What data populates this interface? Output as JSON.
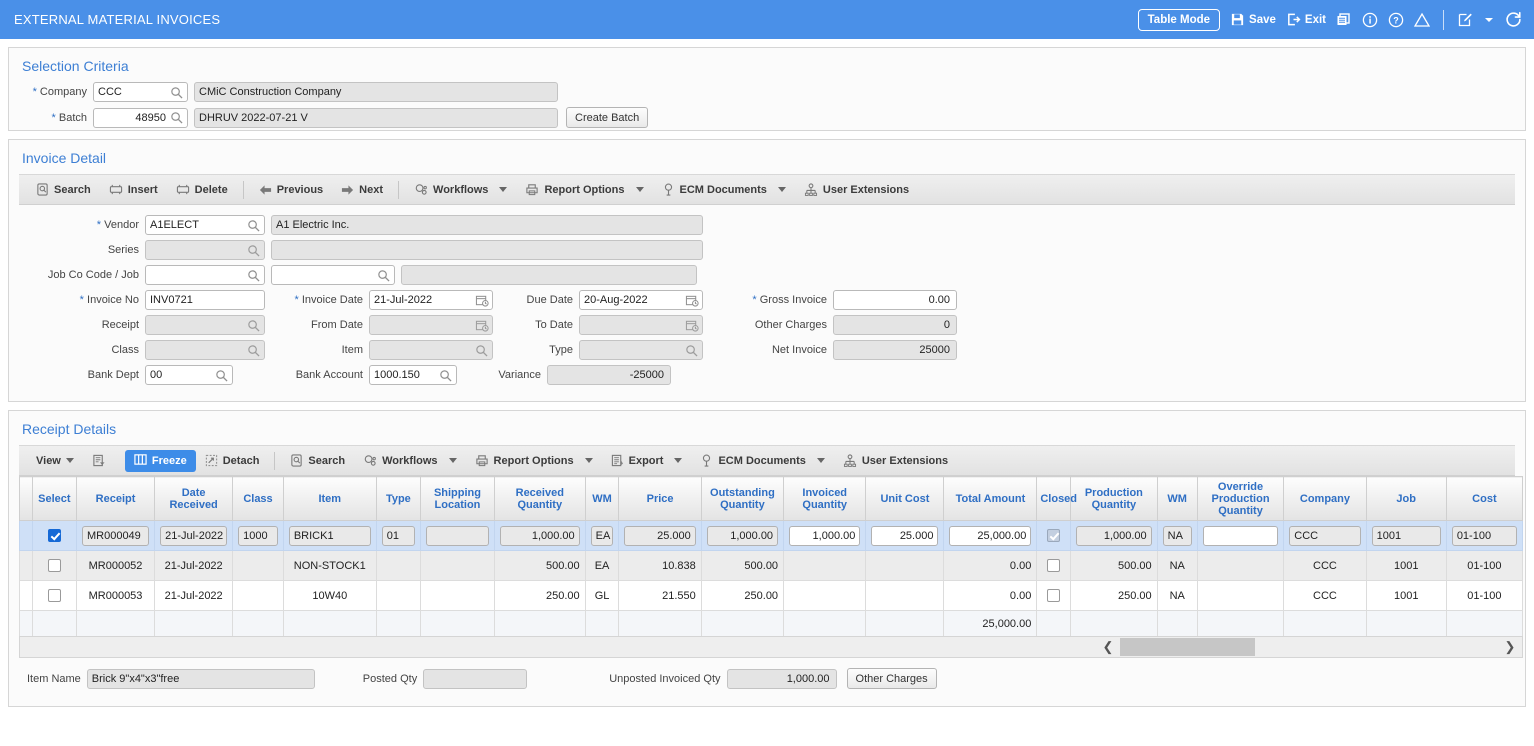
{
  "header": {
    "title": "EXTERNAL MATERIAL INVOICES",
    "table_mode_label": "Table Mode",
    "save_label": "Save",
    "exit_label": "Exit",
    "accent_color": "#4a90e8",
    "icons": [
      "save-icon",
      "exit-icon",
      "copy-icon",
      "info-icon",
      "help-icon",
      "warning-icon",
      "edit-icon",
      "chevron-down-icon",
      "refresh-icon"
    ]
  },
  "selection_criteria": {
    "title": "Selection Criteria",
    "company_label": "Company",
    "company_code": "CCC",
    "company_name": "CMiC Construction Company",
    "batch_label": "Batch",
    "batch_no": "48950",
    "batch_desc": "DHRUV 2022-07-21 V",
    "create_batch_label": "Create Batch"
  },
  "invoice_detail": {
    "title": "Invoice Detail",
    "toolbar": [
      {
        "label": "Search",
        "icon": "search-icon",
        "caret": false
      },
      {
        "label": "Insert",
        "icon": "insert-icon",
        "caret": false
      },
      {
        "label": "Delete",
        "icon": "delete-icon",
        "caret": false
      },
      {
        "label": "Previous",
        "icon": "arrow-left-icon",
        "caret": false
      },
      {
        "label": "Next",
        "icon": "arrow-right-icon",
        "caret": false
      },
      {
        "label": "Workflows",
        "icon": "workflows-icon",
        "caret": true
      },
      {
        "label": "Report Options",
        "icon": "printer-icon",
        "caret": true
      },
      {
        "label": "ECM Documents",
        "icon": "ecm-icon",
        "caret": true
      },
      {
        "label": "User Extensions",
        "icon": "user-extensions-icon",
        "caret": false
      }
    ],
    "fields": {
      "vendor_label": "Vendor",
      "vendor_code": "A1ELECT",
      "vendor_name": "A1 Electric Inc.",
      "series_label": "Series",
      "series_code": "",
      "series_desc": "",
      "jobco_label": "Job Co Code / Job",
      "jobco_code": "",
      "job_code": "",
      "job_desc": "",
      "invoice_no_label": "Invoice No",
      "invoice_no": "INV0721",
      "receipt_label": "Receipt",
      "receipt": "",
      "class_label": "Class",
      "class": "",
      "bank_dept_label": "Bank Dept",
      "bank_dept": "00",
      "invoice_date_label": "Invoice Date",
      "invoice_date": "21-Jul-2022",
      "from_date_label": "From Date",
      "from_date": "",
      "item_label": "Item",
      "item": "",
      "bank_account_label": "Bank Account",
      "bank_account": "1000.150",
      "due_date_label": "Due Date",
      "due_date": "20-Aug-2022",
      "to_date_label": "To Date",
      "to_date": "",
      "type_label": "Type",
      "type": "",
      "variance_label": "Variance",
      "variance": "-25000",
      "gross_invoice_label": "Gross Invoice",
      "gross_invoice": "0.00",
      "other_charges_label": "Other Charges",
      "other_charges": "0",
      "net_invoice_label": "Net Invoice",
      "net_invoice": "25000"
    }
  },
  "receipt_details": {
    "title": "Receipt Details",
    "toolbar": {
      "view_label": "View",
      "query_icon": "query-by-example-icon",
      "freeze_label": "Freeze",
      "detach_label": "Detach",
      "search_label": "Search",
      "workflows_label": "Workflows",
      "report_options_label": "Report Options",
      "export_label": "Export",
      "ecm_documents_label": "ECM Documents",
      "user_extensions_label": "User Extensions"
    },
    "columns": [
      "Select",
      "Receipt",
      "Date Received",
      "Class",
      "Item",
      "Type",
      "Shipping Location",
      "Received Quantity",
      "WM",
      "Price",
      "Outstanding Quantity",
      "Invoiced Quantity",
      "Unit Cost",
      "Total Amount",
      "Closed",
      "Production Quantity",
      "WM",
      "Override Production Quantity",
      "Company",
      "Job",
      "Cost"
    ],
    "rows": [
      {
        "selected": true,
        "select": true,
        "receipt": "MR000049",
        "date_received": "21-Jul-2022",
        "class": "1000",
        "item": "BRICK1",
        "type": "01",
        "shipping_location": "",
        "received_quantity": "1,000.00",
        "wm": "EA",
        "price": "25.000",
        "outstanding_quantity": "1,000.00",
        "invoiced_quantity": "1,000.00",
        "unit_cost": "25.000",
        "total_amount": "25,000.00",
        "closed": true,
        "production_quantity": "1,000.00",
        "wm2": "NA",
        "override_production_quantity": "",
        "company": "CCC",
        "job": "1001",
        "cost": "01-100"
      },
      {
        "selected": false,
        "select": false,
        "receipt": "MR000052",
        "date_received": "21-Jul-2022",
        "class": "",
        "item": "NON-STOCK1",
        "type": "",
        "shipping_location": "",
        "received_quantity": "500.00",
        "wm": "EA",
        "price": "10.838",
        "outstanding_quantity": "500.00",
        "invoiced_quantity": "",
        "unit_cost": "",
        "total_amount": "0.00",
        "closed": false,
        "production_quantity": "500.00",
        "wm2": "NA",
        "override_production_quantity": "",
        "company": "CCC",
        "job": "1001",
        "cost": "01-100"
      },
      {
        "selected": false,
        "select": false,
        "receipt": "MR000053",
        "date_received": "21-Jul-2022",
        "class": "",
        "item": "10W40",
        "type": "",
        "shipping_location": "",
        "received_quantity": "250.00",
        "wm": "GL",
        "price": "21.550",
        "outstanding_quantity": "250.00",
        "invoiced_quantity": "",
        "unit_cost": "",
        "total_amount": "0.00",
        "closed": false,
        "production_quantity": "250.00",
        "wm2": "NA",
        "override_production_quantity": "",
        "company": "CCC",
        "job": "1001",
        "cost": "01-100"
      }
    ],
    "totals": {
      "total_amount": "25,000.00"
    }
  },
  "footer": {
    "item_name_label": "Item Name",
    "item_name": "Brick 9\"x4\"x3\"free",
    "posted_qty_label": "Posted Qty",
    "posted_qty": "",
    "unposted_invoiced_qty_label": "Unposted Invoiced Qty",
    "unposted_invoiced_qty": "1,000.00",
    "other_charges_label": "Other Charges"
  }
}
